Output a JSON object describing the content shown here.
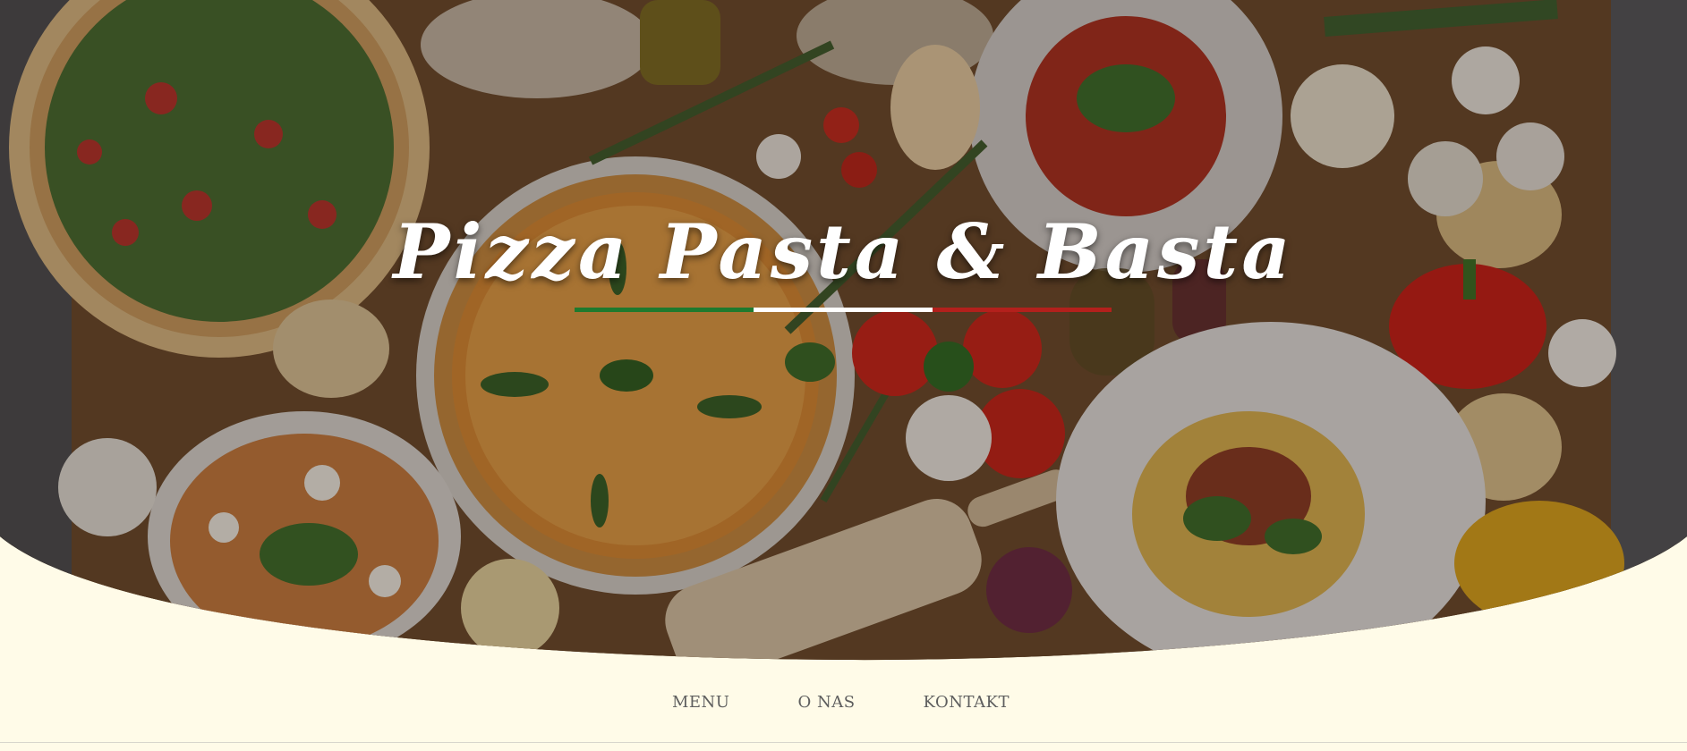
{
  "hero": {
    "title": "Pizza Pasta & Basta",
    "flag_colors": [
      "#1f7a2e",
      "#ffffff",
      "#b3201c"
    ]
  },
  "nav": {
    "items": [
      {
        "label": "MENU"
      },
      {
        "label": "O NAS"
      },
      {
        "label": "KONTAKT"
      }
    ]
  },
  "colors": {
    "page_background": "#fffbe8",
    "nav_text": "#5e5e5e"
  }
}
